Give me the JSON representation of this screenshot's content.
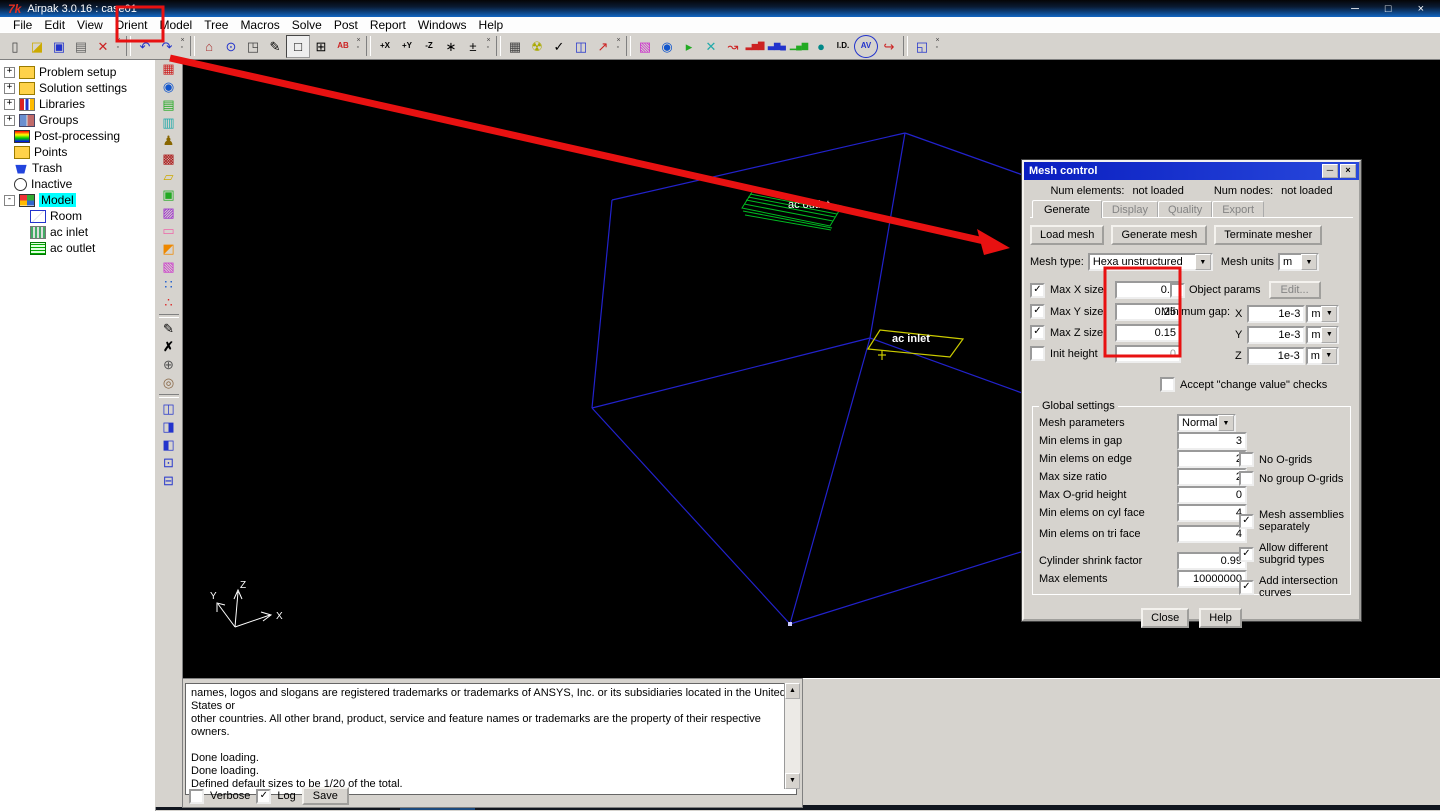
{
  "window": {
    "logo": "7k",
    "title": "Airpak 3.0.16 : case01",
    "minimize": "─",
    "maximize": "□",
    "close": "×"
  },
  "menu": {
    "items": [
      "File",
      "Edit",
      "View",
      "Orient",
      "Model",
      "Tree",
      "Macros",
      "Solve",
      "Post",
      "Report",
      "Windows",
      "Help"
    ]
  },
  "toolbar": {
    "glyphs": [
      "▯",
      "◪",
      "▣",
      "▤",
      "✕",
      "↶",
      "↷",
      "⌂",
      "⊙",
      "◳",
      "✎",
      "□",
      "⊞",
      "AB",
      "+X",
      "+Y",
      "-Z",
      "∗",
      "±",
      "▦",
      "☢",
      "✓",
      "◫",
      "↗",
      "▧",
      "◉",
      "▸",
      "✕",
      "↝",
      "▂▅▇",
      "▃▆▄",
      "▁▄▆",
      "●",
      "I.D.",
      "AV",
      "↪",
      "◱"
    ]
  },
  "side_toolbar": {
    "glyphs": [
      "▦",
      "◉",
      "▤",
      "▥",
      "♟",
      "▩",
      "▱",
      "▣",
      "▨",
      "▭",
      "◩",
      "▧",
      "∷",
      "∴",
      "✎",
      "✗",
      "⊕",
      "◎",
      "◫",
      "◨",
      "◧",
      "⊡",
      "⊟"
    ]
  },
  "tree": {
    "items": [
      {
        "label": "Problem setup"
      },
      {
        "label": "Solution settings"
      },
      {
        "label": "Libraries"
      },
      {
        "label": "Groups"
      },
      {
        "label": "Post-processing"
      },
      {
        "label": "Points"
      },
      {
        "label": "Trash"
      },
      {
        "label": "Inactive"
      },
      {
        "label": "Model"
      },
      {
        "label": "Room"
      },
      {
        "label": "ac inlet"
      },
      {
        "label": "ac outlet"
      }
    ],
    "expand_plus": "+",
    "expand_minus": "-"
  },
  "viewport": {
    "outlet_label": "ac outlet",
    "inlet_label": "ac inlet",
    "axis": {
      "x": "X",
      "y": "Y",
      "z": "Z"
    },
    "wire_color": "#2222cc",
    "outlet_color": "#00bb22",
    "inlet_color": "#cccc00"
  },
  "dialog": {
    "title": "Mesh control",
    "minimize": "─",
    "close": "×",
    "num_elements_label": "Num elements:",
    "num_elements_value": "not loaded",
    "num_nodes_label": "Num nodes:",
    "num_nodes_value": "not loaded",
    "tabs": [
      "Generate",
      "Display",
      "Quality",
      "Export"
    ],
    "buttons": {
      "load": "Load mesh",
      "generate": "Generate mesh",
      "terminate": "Terminate mesher"
    },
    "mesh_type_label": "Mesh type:",
    "mesh_type_value": "Hexa unstructured",
    "mesh_units_label": "Mesh units",
    "mesh_units_value": "m",
    "size_rows": [
      {
        "label": "Max X size",
        "value": "0.2",
        "checked": true
      },
      {
        "label": "Max Y size",
        "value": "0.25",
        "checked": true
      },
      {
        "label": "Max Z size",
        "value": "0.15",
        "checked": true
      },
      {
        "label": "Init height",
        "value": "0",
        "checked": false
      }
    ],
    "object_params_label": "Object params",
    "edit_button": "Edit...",
    "min_gap_label": "Minimum gap:",
    "gap_rows": [
      {
        "axis": "X",
        "value": "1e-3",
        "unit": "m"
      },
      {
        "axis": "Y",
        "value": "1e-3",
        "unit": "m"
      },
      {
        "axis": "Z",
        "value": "1e-3",
        "unit": "m"
      }
    ],
    "accept_label": "Accept \"change value\" checks",
    "global": {
      "legend": "Global settings",
      "mesh_params_label": "Mesh parameters",
      "mesh_params_value": "Normal",
      "rows": [
        {
          "label": "Min elems in gap",
          "value": "3"
        },
        {
          "label": "Min elems on edge",
          "value": "2"
        },
        {
          "label": "Max size ratio",
          "value": "2"
        },
        {
          "label": "Max O-grid height",
          "value": "0"
        },
        {
          "label": "Min elems on cyl face",
          "value": "4"
        },
        {
          "label": "Min elems on tri face",
          "value": "4"
        },
        {
          "label": "Cylinder shrink factor",
          "value": "0.99"
        },
        {
          "label": "Max elements",
          "value": "10000000"
        }
      ],
      "checks": [
        {
          "label": "No O-grids",
          "checked": false
        },
        {
          "label": "No group O-grids",
          "checked": false
        },
        {
          "label": "Mesh assemblies separately",
          "checked": true
        },
        {
          "label": "Allow different subgrid types",
          "checked": true
        },
        {
          "label": "Add intersection curves",
          "checked": true
        }
      ]
    },
    "close_button": "Close",
    "help_button": "Help"
  },
  "console": {
    "text": "names, logos and slogans are registered trademarks or trademarks of ANSYS, Inc. or its subsidiaries located in the United States or\nother countries. All other brand, product, service and feature names or trademarks are the property of their respective owners.\n\nDone loading.\nDone loading.\nDefined default sizes to be 1/20 of the total.",
    "verbose_label": "Verbose",
    "log_label": "Log",
    "save_button": "Save"
  },
  "annotations": {
    "color": "#e81111"
  }
}
